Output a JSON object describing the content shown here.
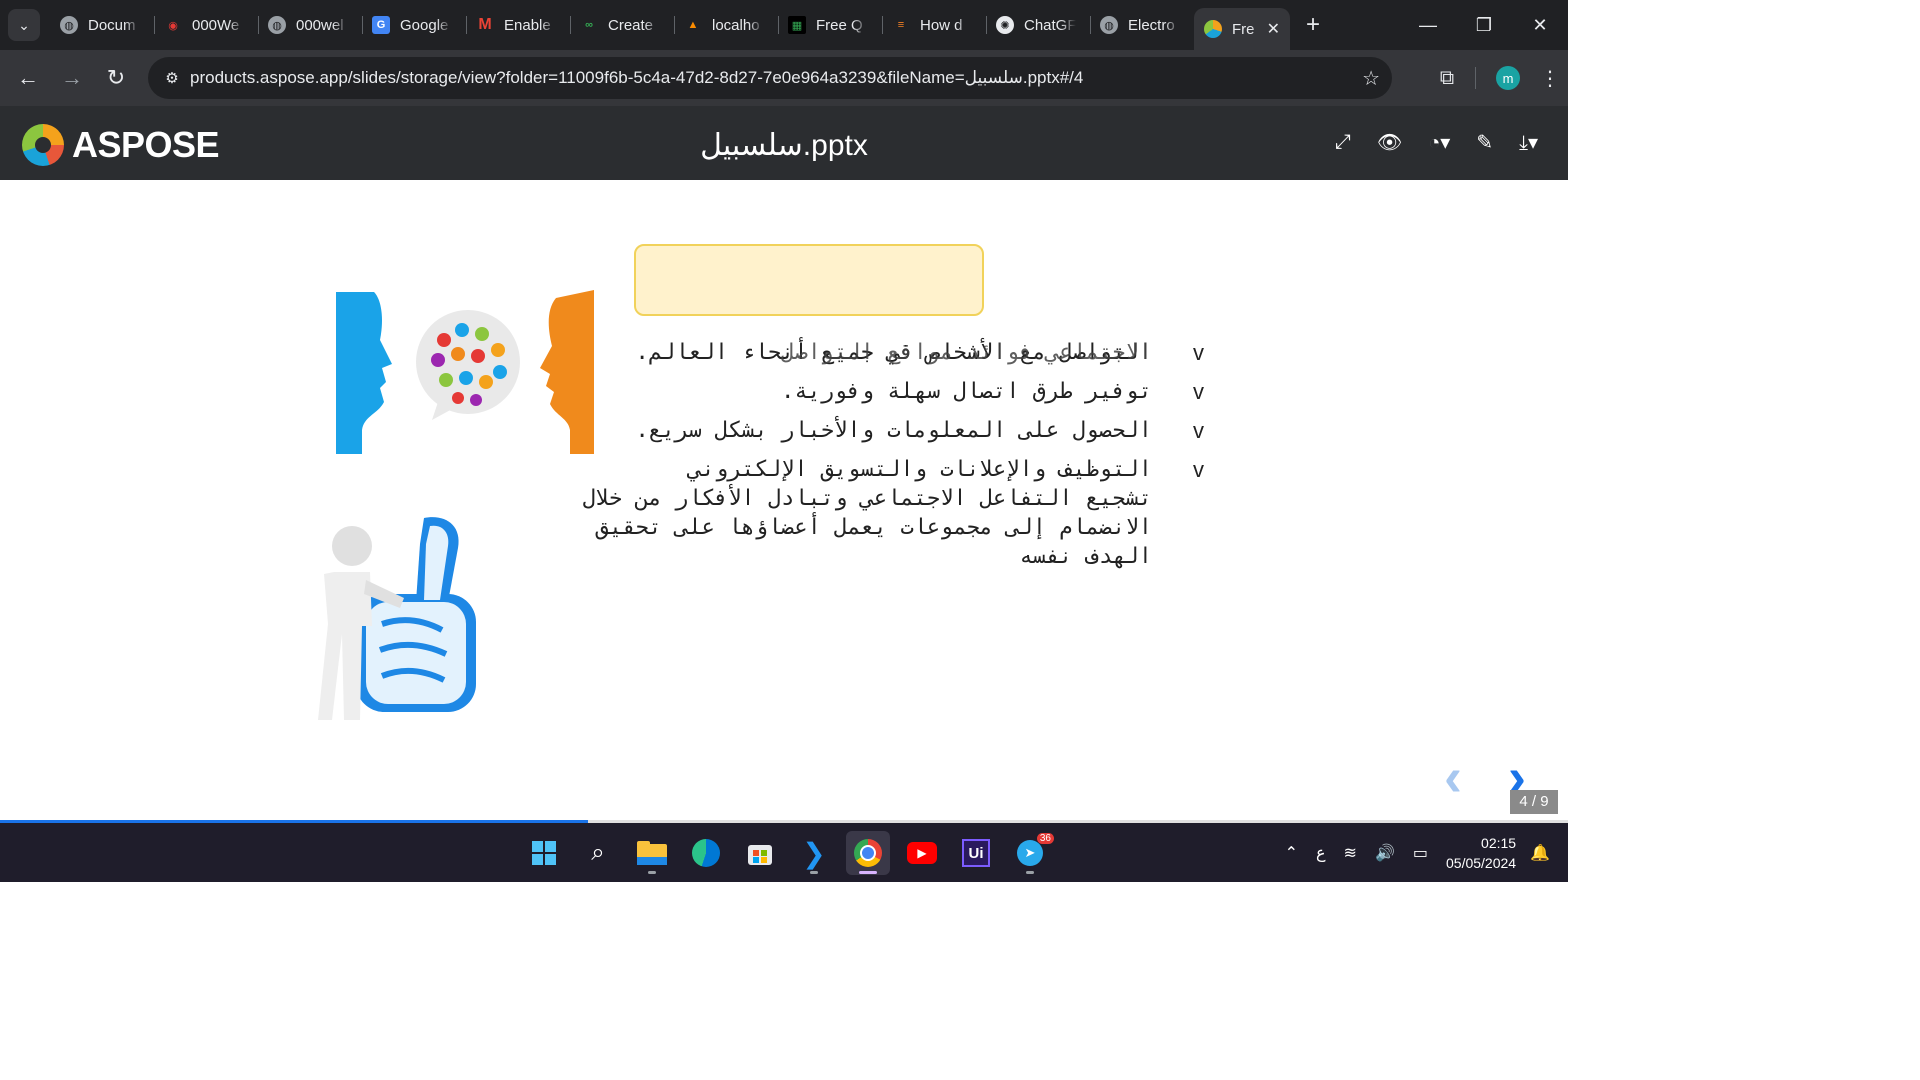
{
  "browser": {
    "tabs": [
      {
        "title": "Docum",
        "favicon": "globe-icon"
      },
      {
        "title": "000We",
        "favicon": "000webhost-icon"
      },
      {
        "title": "000wel",
        "favicon": "globe-icon"
      },
      {
        "title": "Google",
        "favicon": "google-translate-icon"
      },
      {
        "title": "Enable",
        "favicon": "gmail-icon"
      },
      {
        "title": "Create",
        "favicon": "create-icon"
      },
      {
        "title": "localho",
        "favicon": "xampp-icon"
      },
      {
        "title": "Free Q",
        "favicon": "qr-icon"
      },
      {
        "title": "How d",
        "favicon": "stackoverflow-icon"
      },
      {
        "title": "ChatGF",
        "favicon": "chatgpt-icon"
      },
      {
        "title": "Electro",
        "favicon": "globe-icon"
      },
      {
        "title": "Fre",
        "favicon": "aspose-icon",
        "active": true
      }
    ],
    "url": "products.aspose.app/slides/storage/view?folder=11009f6b-5c4a-47d2-8d27-7e0e964a3239&fileName=سلسبيل.pptx#/4",
    "profile_initial": "m"
  },
  "app": {
    "logo_text": "ASPOSE",
    "doc_title": "سلسبيل.pptx"
  },
  "slide": {
    "bullet_mark": "v",
    "bullets": [
      {
        "line1": "التواصل مع الأشخاص في جميع أنحاء العالم.",
        "line2": "الاجتماعي فوائد مواقع التواصل"
      },
      {
        "line1": "توفير طرق اتصال سهلة وفورية."
      },
      {
        "line1": "الحصول على المعلومات والأخبار بشكل سريع."
      },
      {
        "line1": "التوظيف والإعلانات والتسويق الإلكتروني",
        "line2": "تشجيع التفاعل الاجتماعي وتبادل الأفكار من خلال الانضمام إلى مجموعات يعمل أعضاؤها على تحقيق الهدف نفسه"
      }
    ],
    "page_indicator": "4 / 9",
    "progress": 0.375
  },
  "taskbar": {
    "apps": [
      "windows-start-icon",
      "search-icon",
      "file-explorer-icon",
      "edge-icon",
      "store-icon",
      "vscode-icon",
      "chrome-icon",
      "youtube-icon",
      "uipath-icon",
      "telegram-icon"
    ],
    "telegram_badge": "36",
    "lang": "ع",
    "time": "02:15",
    "date": "05/05/2024"
  },
  "colors": {
    "accent": "#1a73e8",
    "title_box_fill": "#fff2cc",
    "head_blue": "#1aa3e8",
    "head_orange": "#f08a1c"
  }
}
